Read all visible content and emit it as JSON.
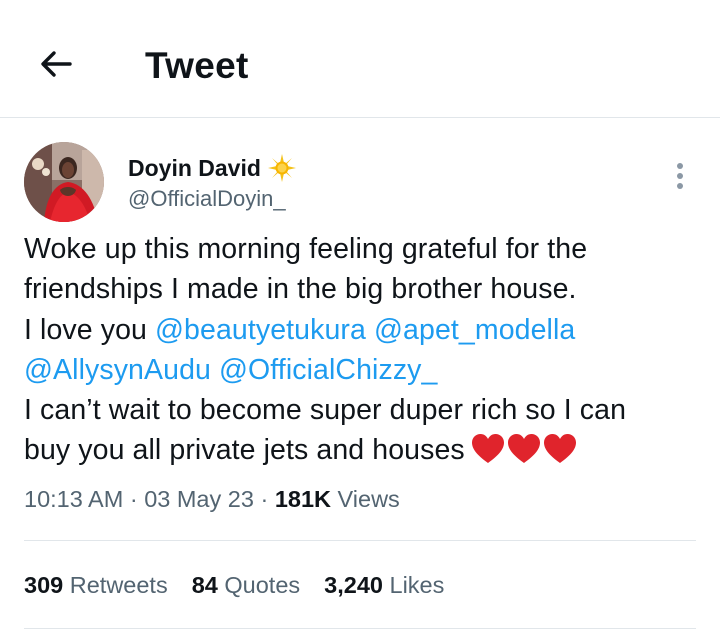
{
  "header": {
    "title": "Tweet",
    "back_icon": "arrow-left-icon"
  },
  "author": {
    "display_name": "Doyin David",
    "verified_icon": "sun-emoji-icon",
    "handle": "@OfficialDoyin_"
  },
  "tweet": {
    "lines": [
      "Woke up this morning feeling grateful for the",
      "friendships I made in the big brother house."
    ],
    "line3_prefix": "I love you ",
    "mentions": [
      "@beautyetukura",
      "@apet_modella",
      "@AllysynAudu",
      "@OfficialChizzy_"
    ],
    "line5": "I can’t wait to become super duper rich so I can",
    "line6": "buy you all private jets and houses",
    "emoji": [
      "red-heart-icon",
      "red-heart-icon",
      "red-heart-icon"
    ]
  },
  "meta": {
    "time": "10:13 AM",
    "separator": "·",
    "date": "03 May 23",
    "views_count": "181K",
    "views_label": "Views"
  },
  "stats": {
    "retweets_count": "309",
    "retweets_label": "Retweets",
    "quotes_count": "84",
    "quotes_label": "Quotes",
    "likes_count": "3,240",
    "likes_label": "Likes"
  },
  "colors": {
    "link": "#1d9bf0",
    "text": "#0f1419",
    "secondary": "#536471",
    "heart": "#e0242c",
    "divider": "#e1e6ea"
  }
}
